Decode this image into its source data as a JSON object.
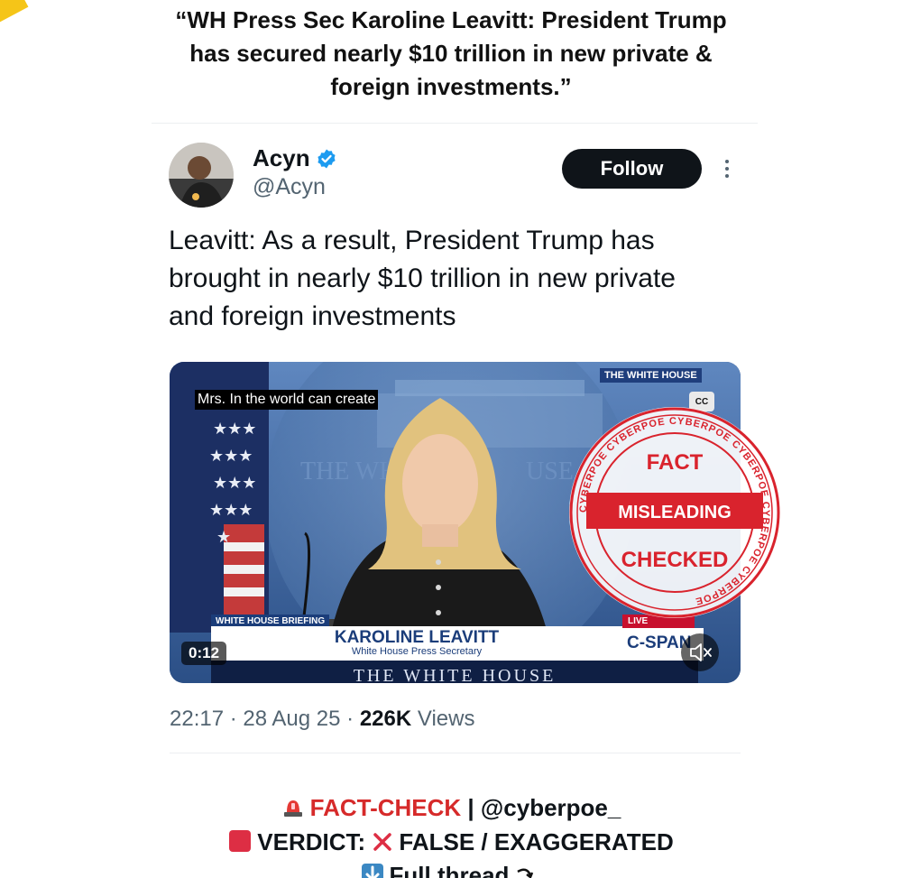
{
  "headline": {
    "line1": "“WH Press Sec Karoline Leavitt: President Trump",
    "line2": "has secured nearly $10 trillion in new private &",
    "line3": "foreign investments.”"
  },
  "tweet": {
    "author_name": "Acyn",
    "handle": "@Acyn",
    "follow_label": "Follow",
    "text_line1": "Leavitt: As a result, President Trump has",
    "text_line2": "brought in nearly $10 trillion in new private",
    "text_line3": "and foreign investments",
    "timestamp": "22:17 · 28 Aug 25 · ",
    "views_count": "226K",
    "views_label": " Views"
  },
  "video": {
    "caption": "Mrs. In the world can create",
    "corner_label": "THE WHITE HOUSE",
    "cc_label": "CC",
    "briefing_tag": "WHITE HOUSE BRIEFING",
    "speaker_name": "KAROLINE LEAVITT",
    "speaker_role": "White House Press Secretary",
    "live_label": "LIVE",
    "network": "C-SPAN",
    "banner": "THE WHITE HOUSE",
    "duration": "0:12"
  },
  "stamp": {
    "ring_text": "CYBERPOE CYBERPOE CYBERPOE CYBERPOE CYBERPOE CYBERPOE ",
    "top": "FACT",
    "middle": "MISLEADING",
    "bottom": "CHECKED",
    "color": "#d9232d"
  },
  "factcheck": {
    "label": "FACT-CHECK",
    "handle": " | @cyberpoe_",
    "verdict_label": "VERDICT: ",
    "verdict_value": "FALSE / EXAGGERATED",
    "thread_label": "Full thread"
  },
  "colors": {
    "accent_red": "#d62a2a",
    "verified_blue": "#1d9bf0",
    "follow_bg": "#0f1419"
  }
}
